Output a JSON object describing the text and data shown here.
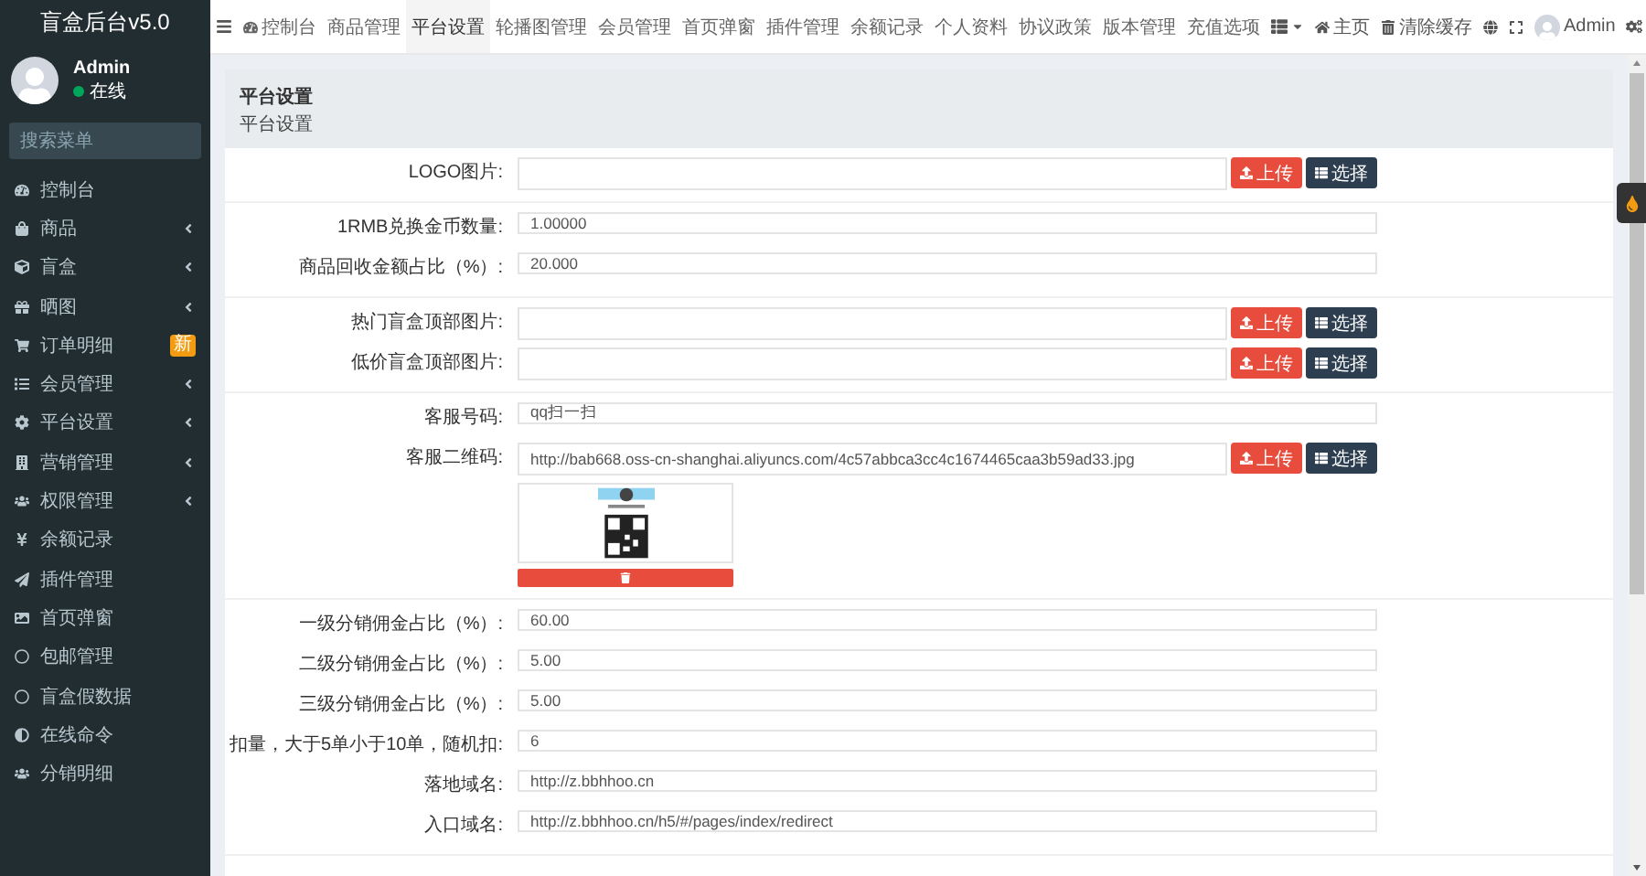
{
  "sidebar": {
    "title": "盲盒后台v5.0",
    "user": {
      "name": "Admin",
      "status": "在线",
      "online": true
    },
    "search": {
      "placeholder": "搜索菜单"
    },
    "items": [
      {
        "label": "控制台",
        "has_children": false
      },
      {
        "label": "商品",
        "has_children": true
      },
      {
        "label": "盲盒",
        "has_children": true
      },
      {
        "label": "晒图",
        "has_children": true
      },
      {
        "label": "订单明细",
        "has_children": false,
        "badge": {
          "text": "新",
          "color": "#f39c12"
        }
      },
      {
        "label": "会员管理",
        "has_children": true
      },
      {
        "label": "平台设置",
        "has_children": true
      },
      {
        "label": "营销管理",
        "has_children": true
      },
      {
        "label": "权限管理",
        "has_children": true
      },
      {
        "label": "余额记录",
        "has_children": false
      },
      {
        "label": "插件管理",
        "has_children": false
      },
      {
        "label": "首页弹窗",
        "has_children": false
      },
      {
        "label": "包邮管理",
        "has_children": false
      },
      {
        "label": "盲盒假数据",
        "has_children": false
      },
      {
        "label": "在线命令",
        "has_children": false
      },
      {
        "label": "分销明细",
        "has_children": false
      }
    ]
  },
  "navbar": {
    "tabs": [
      {
        "label": "控制台",
        "selected": false
      },
      {
        "label": "商品管理",
        "selected": false
      },
      {
        "label": "平台设置",
        "selected": true
      },
      {
        "label": "轮播图管理",
        "selected": false
      },
      {
        "label": "会员管理",
        "selected": false
      },
      {
        "label": "首页弹窗",
        "selected": false
      },
      {
        "label": "插件管理",
        "selected": false
      },
      {
        "label": "余额记录",
        "selected": false
      },
      {
        "label": "个人资料",
        "selected": false
      },
      {
        "label": "协议政策",
        "selected": false
      },
      {
        "label": "版本管理",
        "selected": false
      },
      {
        "label": "充值选项",
        "selected": false
      }
    ],
    "home": "主页",
    "clear_cache": "清除缓存",
    "user": "Admin"
  },
  "content": {
    "header": {
      "title": "平台设置",
      "subtitle": "平台设置"
    },
    "sections": [
      [
        {
          "kind": "upload",
          "label": "LOGO图片:",
          "buttons": [
            "上传",
            "选择"
          ]
        }
      ],
      [
        {
          "kind": "text",
          "label": "1RMB兑换金币数量:",
          "value": "1.00000"
        },
        {
          "kind": "text",
          "label": "商品回收金额占比（%）:",
          "value": "20.000"
        }
      ],
      [
        {
          "kind": "upload",
          "label": "热门盲盒顶部图片:",
          "buttons": [
            "上传",
            "选择"
          ]
        },
        {
          "kind": "upload",
          "label": "低价盲盒顶部图片:",
          "buttons": [
            "上传",
            "选择"
          ]
        }
      ],
      [
        {
          "kind": "text",
          "label": "客服号码:",
          "value": "qq扫一扫"
        },
        {
          "kind": "image",
          "label": "客服二维码:",
          "value": "http://bab668.oss-cn-shanghai.aliyuncs.com/4c57abbca3cc4c1674465caa3b59ad33.jpg",
          "buttons": [
            "上传",
            "选择"
          ]
        }
      ],
      [
        {
          "kind": "text",
          "label": "一级分销佣金占比（%）:",
          "value": "60.00"
        },
        {
          "kind": "text",
          "label": "二级分销佣金占比（%）:",
          "value": "5.00"
        },
        {
          "kind": "text",
          "label": "三级分销佣金占比（%）:",
          "value": "5.00"
        },
        {
          "kind": "text",
          "label": "扣量，大于5单小于10单，随机扣:",
          "value": "6"
        },
        {
          "kind": "text",
          "label": "落地域名:",
          "value": "http://z.bbhhoo.cn"
        },
        {
          "kind": "text",
          "label": "入口域名:",
          "value": "http://z.bbhhoo.cn/h5/#/pages/index/redirect"
        }
      ]
    ]
  }
}
